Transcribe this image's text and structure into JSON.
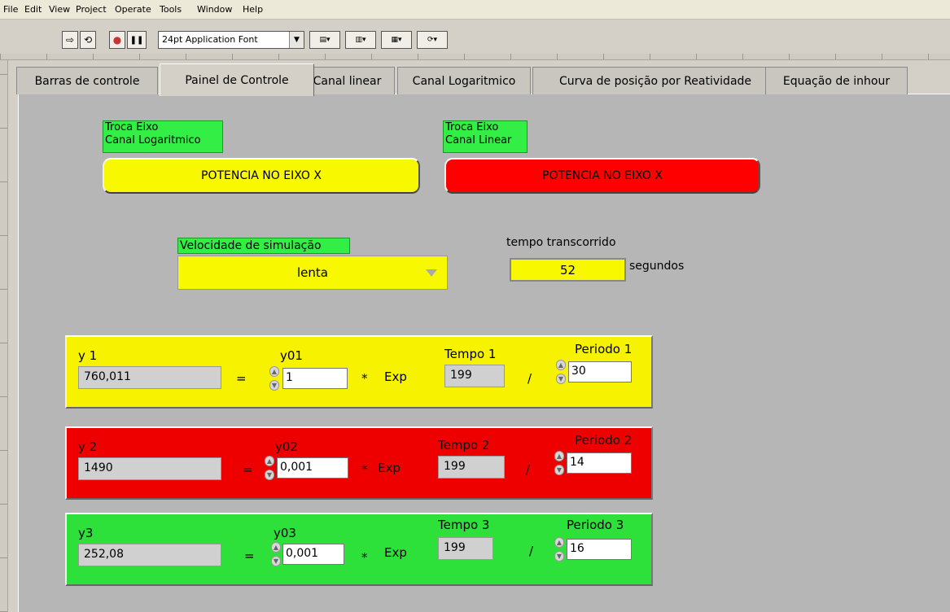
{
  "menu": [
    "File",
    "Edit",
    "View",
    "Project",
    "Operate",
    "Tools",
    "Window",
    "Help"
  ],
  "toolbar": {
    "run": "⇨",
    "run_cont": "⟲",
    "abort": "●",
    "pause": "❚❚",
    "font": "24pt Application Font"
  },
  "tabs": [
    "Barras de controle",
    "Painel de Controle",
    "Canal linear",
    "Canal Logaritmico",
    "Curva de posição por Reatividade",
    "Equação de inhour"
  ],
  "active_tab": "Painel de Controle",
  "troca_log": {
    "label": "Troca Eixo\nCanal Logaritmico",
    "label1": "Troca Eixo",
    "label2": "Canal Logaritmico",
    "button": "POTENCIA NO EIXO X"
  },
  "troca_lin": {
    "label1": "Troca Eixo",
    "label2": "Canal Linear",
    "button": "POTENCIA NO EIXO X"
  },
  "velocidade": {
    "label": "Velocidade de simulação",
    "value": "lenta"
  },
  "tempo": {
    "label": "tempo transcorrido",
    "value": "52",
    "unit": "segundos"
  },
  "clusters": [
    {
      "y_label": "y 1",
      "y_value": "760,011",
      "eq": "=",
      "y0_label": "y01",
      "y0_value": "1",
      "mult": "*",
      "exp": "Exp",
      "t_label": "Tempo 1",
      "t_value": "199",
      "div": "/",
      "p_label": "Periodo 1",
      "p_value": "30",
      "color": "#f6f200"
    },
    {
      "y_label": "y 2",
      "y_value": "1490",
      "eq": "=",
      "y0_label": "y02",
      "y0_value": "0,001",
      "mult": "*",
      "exp": "Exp",
      "t_label": "Tempo 2",
      "t_value": "199",
      "div": "/",
      "p_label": "Periodo 2",
      "p_value": "14",
      "color": "#ee0000"
    },
    {
      "y_label": "y3",
      "y_value": "252,08",
      "eq": "=",
      "y0_label": "y03",
      "y0_value": "0,001",
      "mult": "*",
      "exp": "Exp",
      "t_label": "Tempo 3",
      "t_value": "199",
      "div": "/",
      "p_label": "Periodo 3",
      "p_value": "16",
      "color": "#2ee03a"
    }
  ]
}
